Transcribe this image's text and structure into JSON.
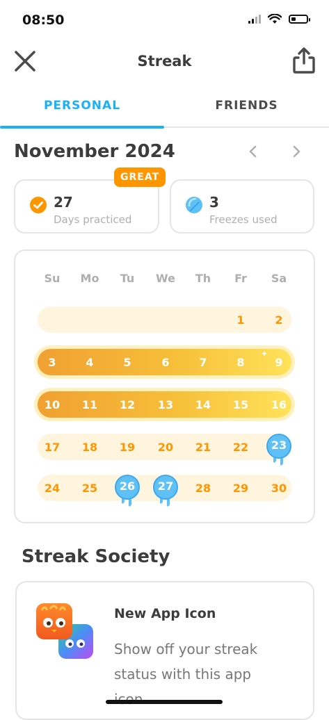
{
  "status_bar": {
    "time": "08:50"
  },
  "header": {
    "title": "Streak"
  },
  "tabs": [
    {
      "label": "PERSONAL",
      "active": true
    },
    {
      "label": "FRIENDS",
      "active": false
    }
  ],
  "calendar": {
    "month_label": "November 2024",
    "weekdays": [
      "Su",
      "Mo",
      "Tu",
      "We",
      "Th",
      "Fr",
      "Sa"
    ],
    "weeks": [
      {
        "days": [
          "",
          "",
          "",
          "",
          "",
          "1",
          "2"
        ],
        "style": "pale"
      },
      {
        "days": [
          "3",
          "4",
          "5",
          "6",
          "7",
          "8",
          "9"
        ],
        "style": "hot"
      },
      {
        "days": [
          "10",
          "11",
          "12",
          "13",
          "14",
          "15",
          "16"
        ],
        "style": "hot"
      },
      {
        "days": [
          "17",
          "18",
          "19",
          "20",
          "21",
          "22",
          "23"
        ],
        "style": "pale"
      },
      {
        "days": [
          "24",
          "25",
          "26",
          "27",
          "28",
          "29",
          "30"
        ],
        "style": "pale"
      }
    ],
    "freeze_days": [
      "23",
      "26",
      "27"
    ]
  },
  "stats": {
    "badge": "GREAT",
    "days_practiced": {
      "value": "27",
      "label": "Days practiced"
    },
    "freezes_used": {
      "value": "3",
      "label": "Freezes used"
    }
  },
  "society": {
    "section_title": "Streak Society",
    "card_title": "New App Icon",
    "card_description": "Show off your streak status with this app icon."
  },
  "colors": {
    "accent_blue": "#1cb0f6",
    "streak_orange": "#ff9600",
    "freeze_blue": "#5ec0f5"
  }
}
